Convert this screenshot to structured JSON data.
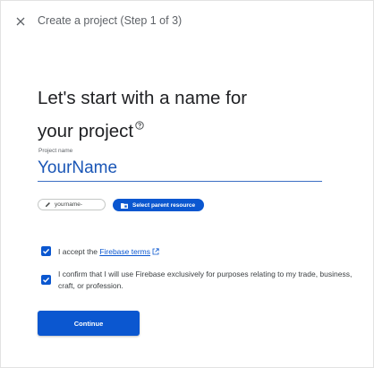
{
  "header": {
    "close_icon": "close-icon",
    "title": "Create a project (Step 1 of 3)"
  },
  "main": {
    "heading_line1": "Let's start with a name for",
    "heading_line2": "your project",
    "help_icon": "help-circle-icon",
    "project_name": {
      "label": "Project name",
      "value": "YourName"
    },
    "project_id_chip": {
      "icon": "pencil-icon",
      "label": "yourname-"
    },
    "select_parent_button": {
      "icon": "folder-icon",
      "label": "Select parent resource"
    },
    "terms_checkbox": {
      "checked": true,
      "prefix": "I accept the ",
      "link": "Firebase terms",
      "link_icon": "open-in-new-icon"
    },
    "purpose_checkbox": {
      "checked": true,
      "line1": "I confirm that I will use Firebase exclusively for purposes relating to my trade, business,",
      "line2": "craft, or profession."
    },
    "continue_label": "Continue"
  },
  "colors": {
    "primary": "#0b57d0",
    "input_text": "#1a56b6",
    "muted_text": "#5f6368"
  }
}
